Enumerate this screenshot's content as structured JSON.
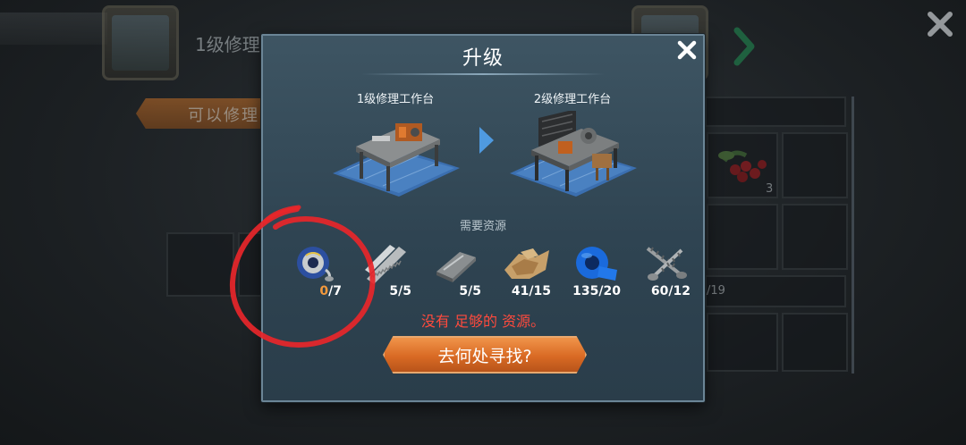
{
  "background": {
    "title": "1级修理",
    "tab_label": "可以修理",
    "berry_count": "3",
    "partial_count": "/19"
  },
  "modal": {
    "title": "升级",
    "from_bench": "1级修理工作台",
    "to_bench": "2级修理工作台",
    "need_label": "需要资源",
    "resources": [
      {
        "icon": "solder-wire-icon",
        "have": "0",
        "need": "7"
      },
      {
        "icon": "saw-blade-icon",
        "text": "5/5"
      },
      {
        "icon": "metal-bar-icon",
        "text": "5/5"
      },
      {
        "icon": "leather-scraps-icon",
        "text": "41/15"
      },
      {
        "icon": "blue-tape-icon",
        "text": "135/20"
      },
      {
        "icon": "screws-icon",
        "text": "60/12"
      }
    ],
    "warning": "没有 足够的 资源。",
    "find_button": "去何处寻找?"
  },
  "colors": {
    "accent_orange": "#d96a24",
    "warning_red": "#ff4a3d",
    "low_count_orange": "#f3993c",
    "modal_blue": "#34495a"
  }
}
